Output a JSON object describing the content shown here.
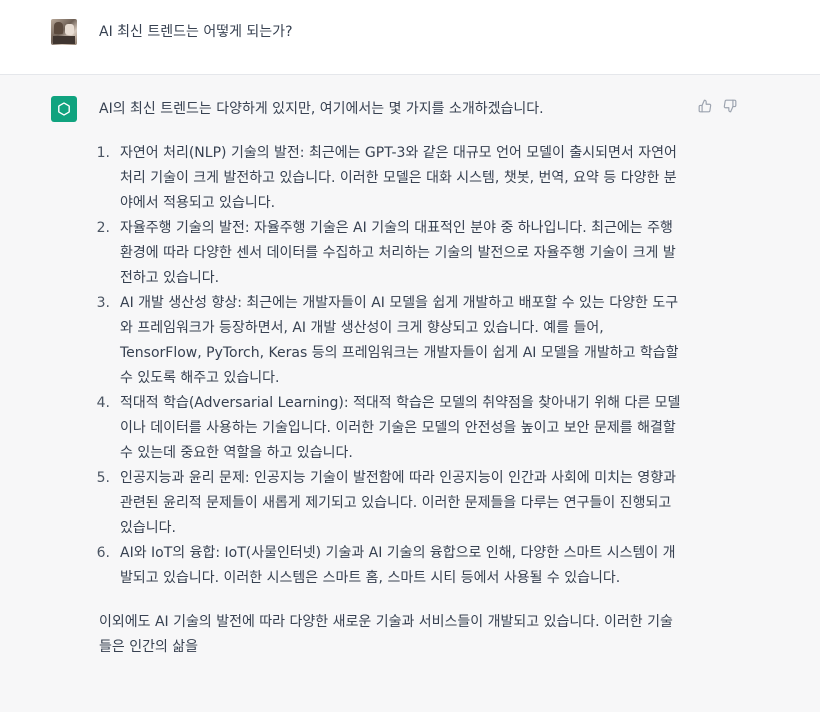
{
  "user_message": {
    "text": "AI 최신 트렌드는 어떻게 되는가?"
  },
  "assistant_message": {
    "intro": "AI의 최신 트렌드는 다양하게 있지만, 여기에서는 몇 가지를 소개하겠습니다.",
    "items": [
      {
        "num": "1.",
        "text": "자연어 처리(NLP) 기술의 발전: 최근에는 GPT-3와 같은 대규모 언어 모델이 출시되면서 자연어 처리 기술이 크게 발전하고 있습니다. 이러한 모델은 대화 시스템, 챗봇, 번역, 요약 등 다양한 분야에서 적용되고 있습니다."
      },
      {
        "num": "2.",
        "text": "자율주행 기술의 발전: 자율주행 기술은 AI 기술의 대표적인 분야 중 하나입니다. 최근에는 주행 환경에 따라 다양한 센서 데이터를 수집하고 처리하는 기술의 발전으로 자율주행 기술이 크게 발전하고 있습니다."
      },
      {
        "num": "3.",
        "text": "AI 개발 생산성 향상: 최근에는 개발자들이 AI 모델을 쉽게 개발하고 배포할 수 있는 다양한 도구와 프레임워크가 등장하면서, AI 개발 생산성이 크게 향상되고 있습니다. 예를 들어, TensorFlow, PyTorch, Keras 등의 프레임워크는 개발자들이 쉽게 AI 모델을 개발하고 학습할 수 있도록 해주고 있습니다."
      },
      {
        "num": "4.",
        "text": "적대적 학습(Adversarial Learning): 적대적 학습은 모델의 취약점을 찾아내기 위해 다른 모델이나 데이터를 사용하는 기술입니다. 이러한 기술은 모델의 안전성을 높이고 보안 문제를 해결할 수 있는데 중요한 역할을 하고 있습니다."
      },
      {
        "num": "5.",
        "text": "인공지능과 윤리 문제: 인공지능 기술이 발전함에 따라 인공지능이 인간과 사회에 미치는 영향과 관련된 윤리적 문제들이 새롭게 제기되고 있습니다. 이러한 문제들을 다루는 연구들이 진행되고 있습니다."
      },
      {
        "num": "6.",
        "text": "AI와 IoT의 융합: IoT(사물인터넷) 기술과 AI 기술의 융합으로 인해, 다양한 스마트 시스템이 개발되고 있습니다. 이러한 시스템은 스마트 홈, 스마트 시티 등에서 사용될 수 있습니다."
      }
    ],
    "outro": "이외에도 AI 기술의 발전에 따라 다양한 새로운 기술과 서비스들이 개발되고 있습니다. 이러한 기술들은 인간의 삶을"
  },
  "icons": {
    "user_avatar": "user-avatar",
    "assistant_logo": "openai-logo-icon",
    "like": "thumbs-up-icon",
    "dislike": "thumbs-down-icon"
  },
  "colors": {
    "assistant_bg": "#f7f7f8",
    "logo_bg": "#10a37f",
    "text": "#374151"
  }
}
